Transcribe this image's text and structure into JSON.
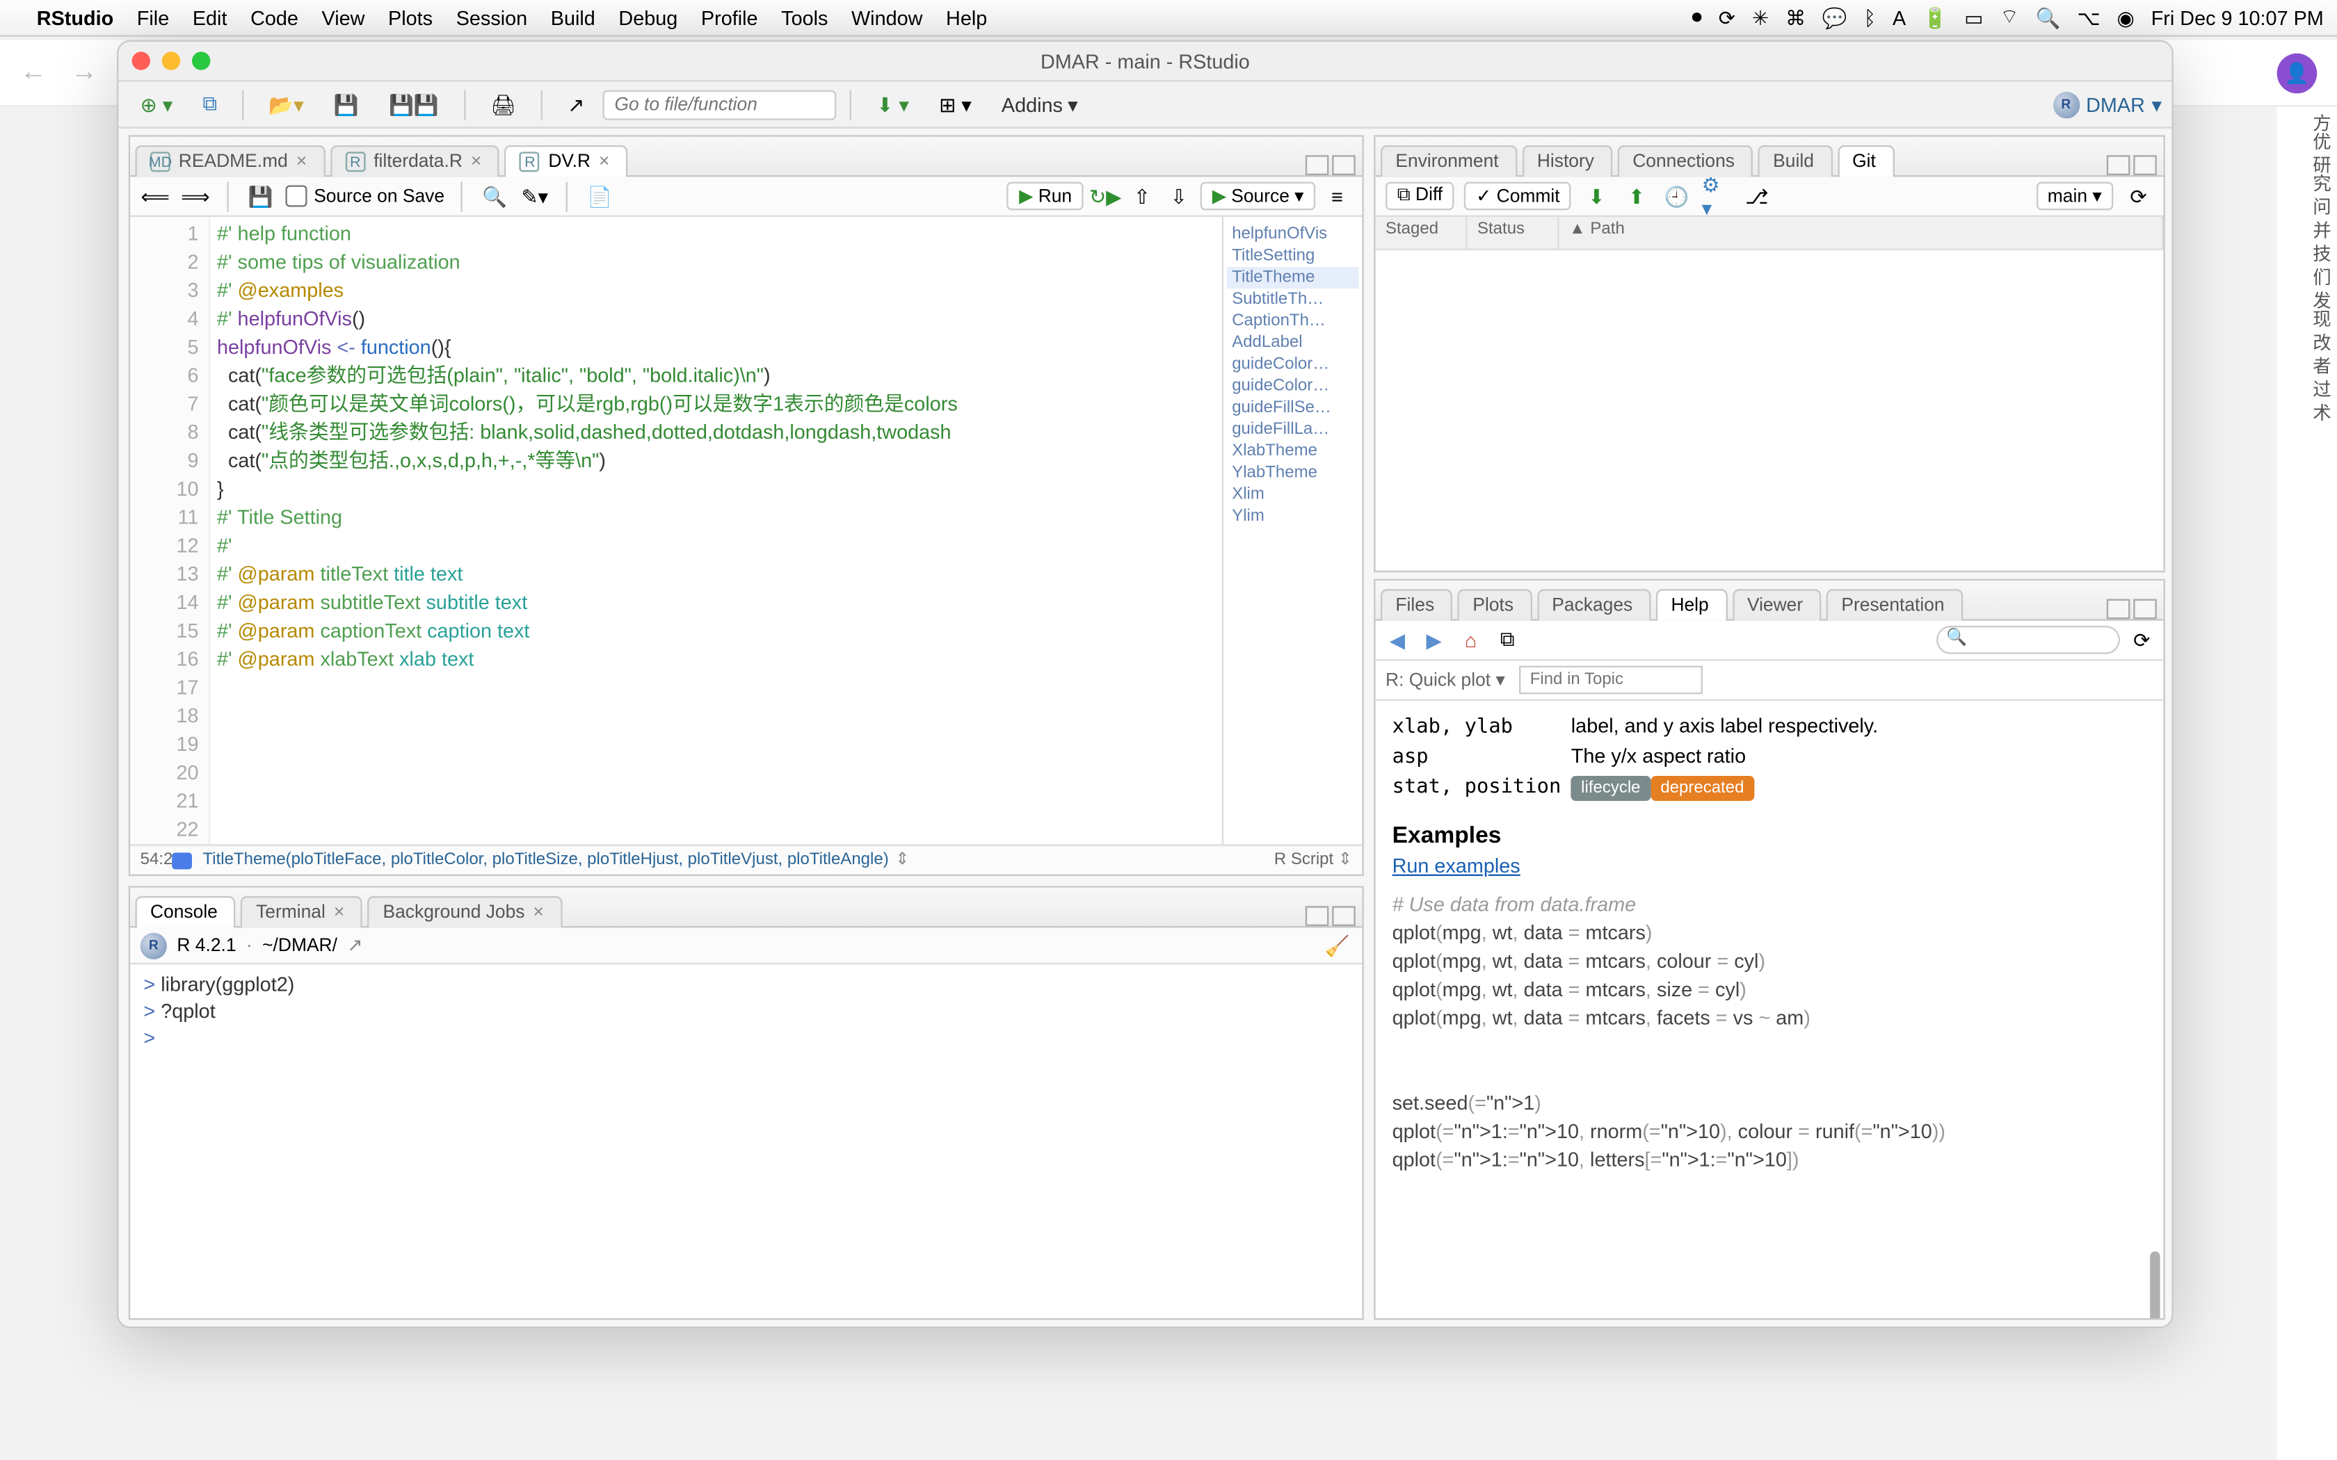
{
  "menubar": {
    "app": "RStudio",
    "items": [
      "File",
      "Edit",
      "Code",
      "View",
      "Plots",
      "Session",
      "Build",
      "Debug",
      "Profile",
      "Tools",
      "Window",
      "Help"
    ],
    "clock": "Fri Dec 9  10:07 PM"
  },
  "window": {
    "title": "DMAR - main - RStudio"
  },
  "maintoolbar": {
    "goto_placeholder": "Go to file/function",
    "addins": "Addins",
    "project": "DMAR"
  },
  "editor": {
    "tabs": [
      {
        "icon": "MD",
        "label": "README.md",
        "active": false
      },
      {
        "icon": "R",
        "label": "filterdata.R",
        "active": false
      },
      {
        "icon": "R",
        "label": "DV.R",
        "active": true
      }
    ],
    "save_on_source": "Source on Save",
    "run": "Run",
    "source": "Source",
    "lines": [
      {
        "n": 1,
        "roxygen": "#' ",
        "tag": "",
        "text": "help function"
      },
      {
        "n": 2,
        "roxygen": "#' ",
        "tag": "",
        "text": "some tips of visualization"
      },
      {
        "n": 3,
        "roxygen": "#' ",
        "tag": "@examples",
        "text": ""
      },
      {
        "n": 4,
        "roxygen": "#' ",
        "tag": "",
        "id": "helpfunOfVis",
        "after": "()"
      },
      {
        "n": 5,
        "raw": ""
      },
      {
        "n": 6,
        "fold": true,
        "id": "helpfunOfVis",
        "assign": " <- ",
        "kw": "function",
        "after": "(){"
      },
      {
        "n": 7,
        "code": "  cat(",
        "str": "\"face参数的可选包括(plain\", \"italic\", \"bold\", \"bold.italic)\\n\"",
        "after": ")"
      },
      {
        "n": 8,
        "code": "  cat(",
        "str": "\"颜色可以是英文单词colors()，可以是rgb,rgb()可以是数字1表示的颜色是colors",
        "after": ""
      },
      {
        "n": 9,
        "code": "  cat(",
        "str": "\"线条类型可选参数包括: blank,solid,dashed,dotted,dotdash,longdash,twodash",
        "after": ""
      },
      {
        "n": 10,
        "code": "  cat(",
        "str": "\"点的类型包括.,o,x,s,d,p,h,+,-,*等等\\n\"",
        "after": ")"
      },
      {
        "n": 11,
        "fold": true,
        "raw": "}"
      },
      {
        "n": 12,
        "raw": ""
      },
      {
        "n": 13,
        "raw": ""
      },
      {
        "n": 14,
        "raw": ""
      },
      {
        "n": 15,
        "raw": ""
      },
      {
        "n": 16,
        "raw": ""
      },
      {
        "n": 17,
        "roxygen": "#' ",
        "tag": "",
        "text": "Title Setting"
      },
      {
        "n": 18,
        "roxygen": "#'",
        "tag": "",
        "text": ""
      },
      {
        "n": 19,
        "roxygen": "#' ",
        "tag": "@param",
        "text": " titleText ",
        "teal": "title text"
      },
      {
        "n": 20,
        "roxygen": "#' ",
        "tag": "@param",
        "text": " subtitleText ",
        "teal": "subtitle text"
      },
      {
        "n": 21,
        "roxygen": "#' ",
        "tag": "@param",
        "text": " captionText ",
        "teal": "caption text"
      },
      {
        "n": 22,
        "roxygen": "#' ",
        "tag": "@param",
        "text": " xlabText ",
        "teal": "xlab text"
      }
    ],
    "outline": [
      "helpfunOfVis",
      "TitleSetting",
      "TitleTheme",
      "SubtitleTh…",
      "CaptionTh…",
      "AddLabel",
      "guideColor…",
      "guideColor…",
      "guideFillSe…",
      "guideFillLa…",
      "XlabTheme",
      "YlabTheme",
      "Xlim",
      "Ylim"
    ],
    "outline_selected": 2,
    "status_pos": "54:2",
    "status_fn": "TitleTheme(ploTitleFace, ploTitleColor, ploTitleSize, ploTitleHjust, ploTitleVjust, ploTitleAngle)",
    "status_lang": "R Script"
  },
  "console": {
    "tabs": [
      "Console",
      "Terminal",
      "Background Jobs"
    ],
    "active": 0,
    "version": "R 4.2.1",
    "wd": "~/DMAR/",
    "lines": [
      "> library(ggplot2)",
      "> ?qplot",
      "> "
    ]
  },
  "env": {
    "tabs": [
      "Environment",
      "History",
      "Connections",
      "Build",
      "Git"
    ],
    "active": 4,
    "diff": "Diff",
    "commit": "Commit",
    "branch": "main",
    "cols": [
      "Staged",
      "Status",
      "▲ Path"
    ]
  },
  "help": {
    "tabs": [
      "Files",
      "Plots",
      "Packages",
      "Help",
      "Viewer",
      "Presentation"
    ],
    "active": 3,
    "topic_label": "R: Quick plot",
    "find_placeholder": "Find in Topic",
    "args": [
      {
        "name": "xlab, ylab",
        "desc": "label, and y axis label respectively."
      },
      {
        "name": "asp",
        "desc": "The y/x aspect ratio"
      },
      {
        "name": "stat, position",
        "desc": ""
      }
    ],
    "badges": [
      "lifecycle",
      "deprecated"
    ],
    "examples_h": "Examples",
    "run_examples": "Run examples",
    "code": [
      {
        "c": "# Use data from data.frame"
      },
      {
        "t": "qplot(mpg, wt, data = mtcars)"
      },
      {
        "t": "qplot(mpg, wt, data = mtcars, colour = cyl)"
      },
      {
        "t": "qplot(mpg, wt, data = mtcars, size = cyl)"
      },
      {
        "t": "qplot(mpg, wt, data = mtcars, facets = vs ~ am)"
      },
      {
        "t": ""
      },
      {
        "t": ""
      },
      {
        "t": "set.seed(1)"
      },
      {
        "t": "qplot(1:10, rnorm(10), colour = runif(10))"
      },
      {
        "t": "qplot(1:10, letters[1:10])"
      }
    ]
  }
}
